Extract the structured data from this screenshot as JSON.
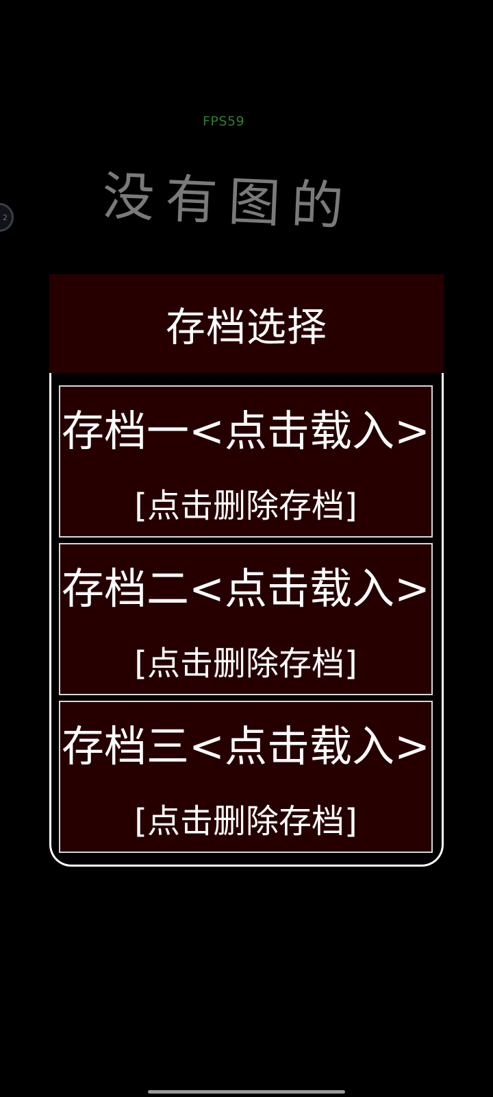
{
  "hud": {
    "fps_label": "FPS59"
  },
  "background": {
    "placeholder_title": "没有图的"
  },
  "floating_button": {
    "label": "2"
  },
  "save_panel": {
    "title": "存档选择",
    "slots": [
      {
        "load_label": "存档一<点击载入>",
        "delete_label": "[点击删除存档]"
      },
      {
        "load_label": "存档二<点击载入>",
        "delete_label": "[点击删除存档]"
      },
      {
        "load_label": "存档三<点击载入>",
        "delete_label": "[点击删除存档]"
      }
    ]
  },
  "colors": {
    "background": "#000000",
    "panel_fill": "#260000",
    "panel_text": "#ffffff",
    "fps_text": "#2e7d32",
    "placeholder_text": "#7a7a7a"
  }
}
